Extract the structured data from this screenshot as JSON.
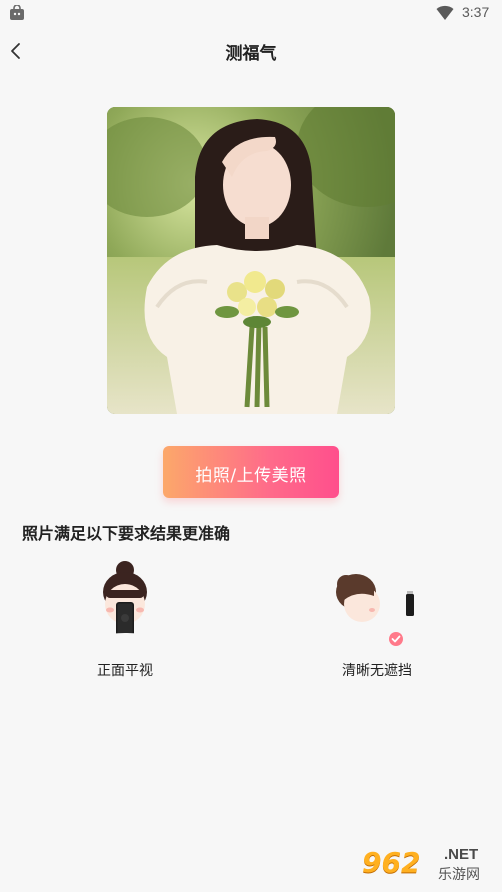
{
  "status_bar": {
    "time": "3:37"
  },
  "nav": {
    "title": "测福气"
  },
  "actions": {
    "upload_label": "拍照/上传美照"
  },
  "requirements": {
    "heading": "照片满足以下要求结果更准确",
    "items": [
      {
        "label": "正面平视"
      },
      {
        "label": "清晰无遮挡"
      }
    ]
  },
  "watermark": {
    "logo": "962",
    "net": ".NET",
    "sub": "乐游网"
  },
  "colors": {
    "accent_start": "#fca86a",
    "accent_end": "#ff4f8c"
  },
  "icons": [
    "app-store-icon",
    "wifi-icon",
    "back-arrow-icon",
    "check-badge-icon"
  ]
}
